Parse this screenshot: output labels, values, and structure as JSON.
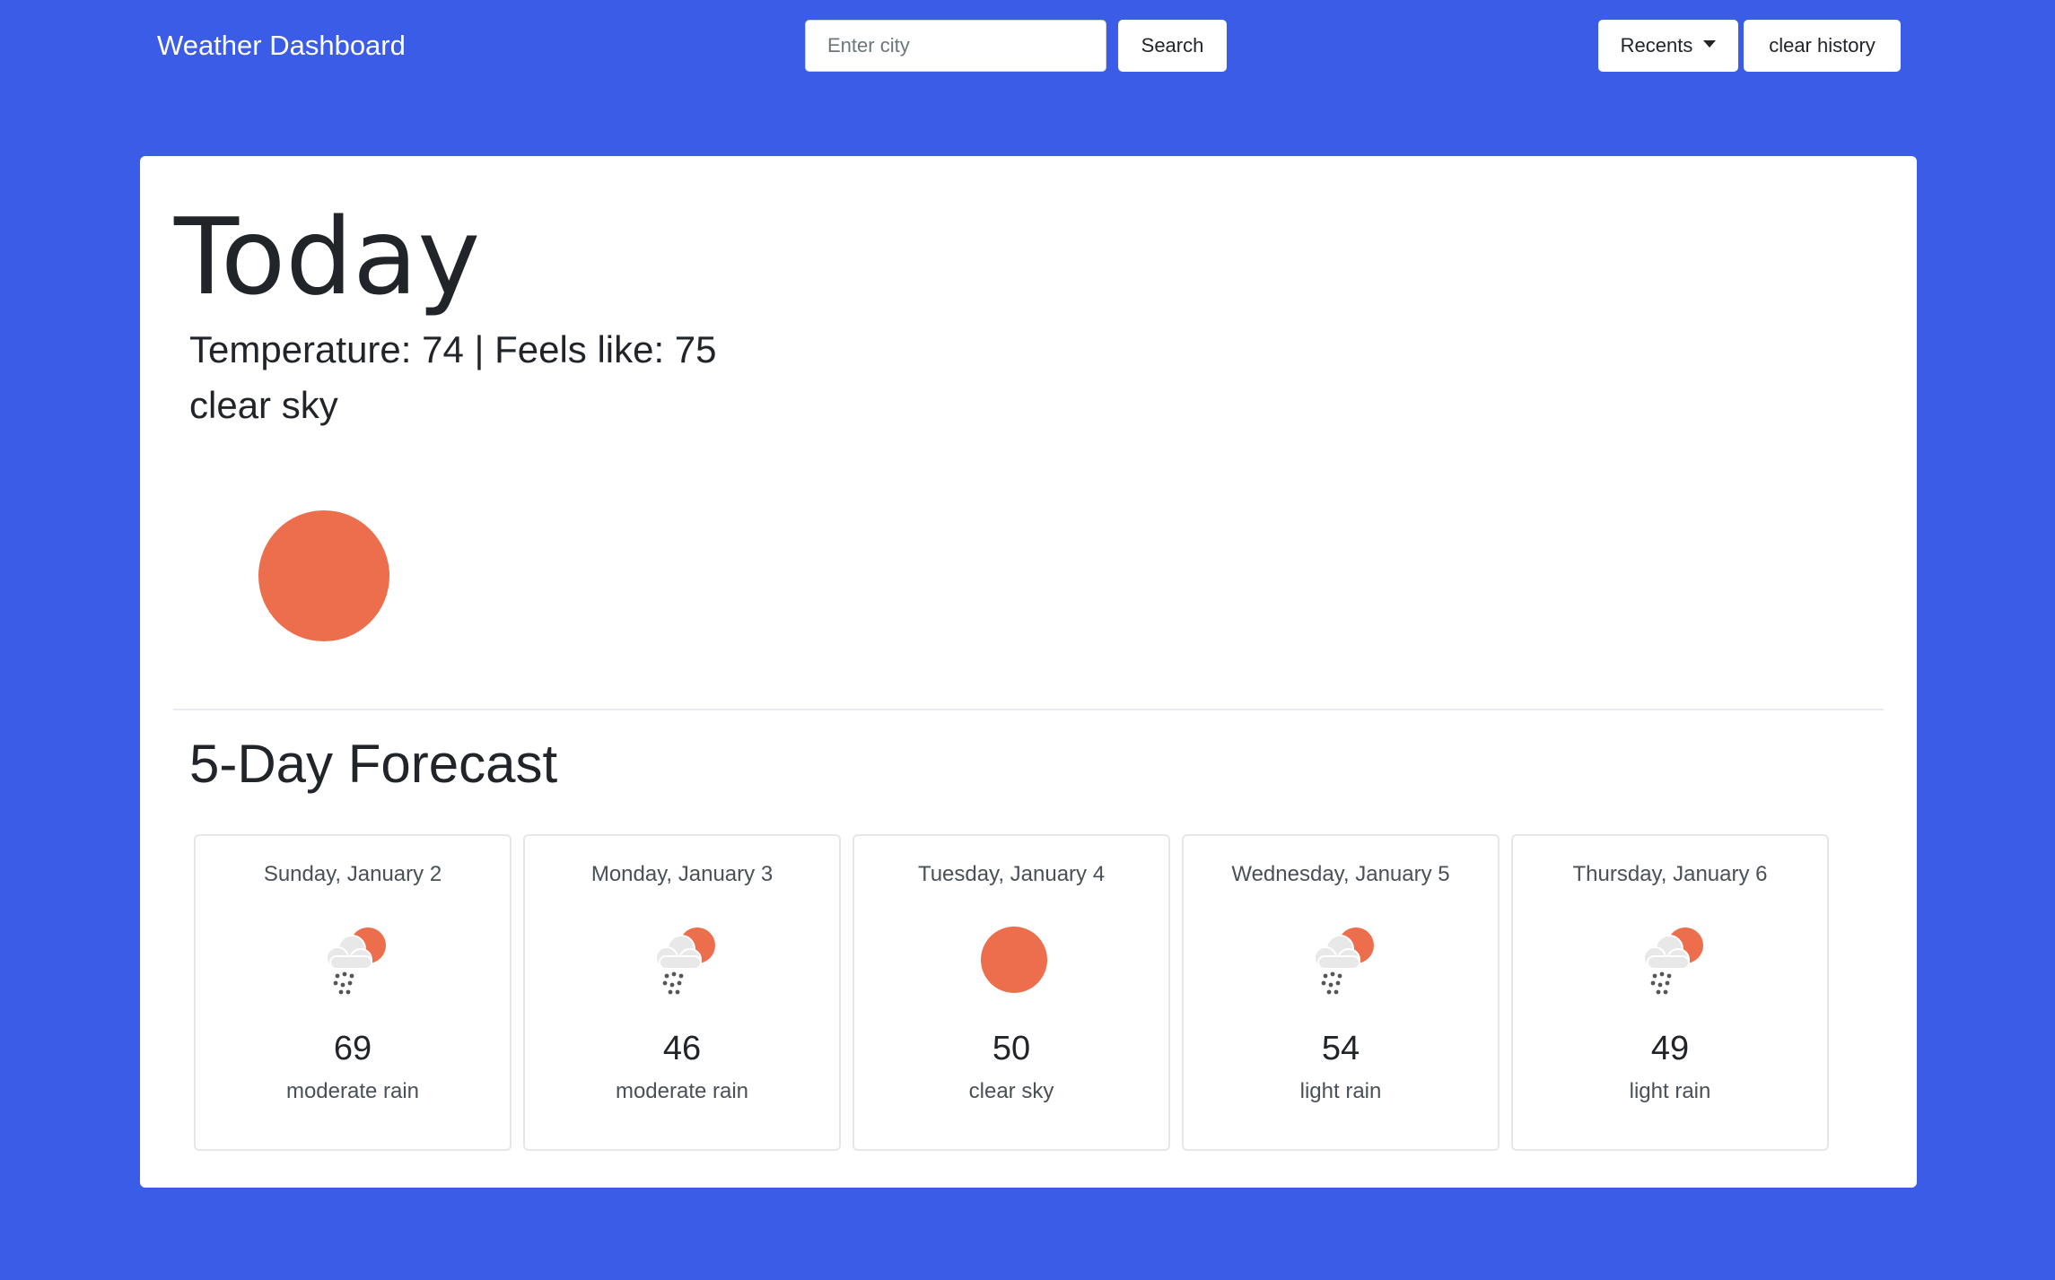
{
  "navbar": {
    "brand": "Weather Dashboard",
    "search_placeholder": "Enter city",
    "search_value": "",
    "search_label": "Search",
    "recents_label": "Recents",
    "clear_label": "clear history"
  },
  "today": {
    "title": "Today",
    "temperature_label": "Temperature: 74 | Feels like: 75",
    "temperature": 74,
    "feels_like": 75,
    "description": "clear sky",
    "icon": "sun-icon"
  },
  "forecast": {
    "title": "5-Day Forecast",
    "days": [
      {
        "date": "Sunday, January 2",
        "temp": "69",
        "desc": "moderate rain",
        "icon": "rain-cloud-sun-icon"
      },
      {
        "date": "Monday, January 3",
        "temp": "46",
        "desc": "moderate rain",
        "icon": "rain-cloud-sun-icon"
      },
      {
        "date": "Tuesday, January 4",
        "temp": "50",
        "desc": "clear sky",
        "icon": "sun-icon"
      },
      {
        "date": "Wednesday, January 5",
        "temp": "54",
        "desc": "light rain",
        "icon": "rain-cloud-sun-icon"
      },
      {
        "date": "Thursday, January 6",
        "temp": "49",
        "desc": "light rain",
        "icon": "rain-cloud-sun-icon"
      }
    ]
  },
  "colors": {
    "background": "#3a5ce6",
    "sun": "#ec6e4c",
    "cloud": "#e8e8e8",
    "rain": "#555555"
  }
}
